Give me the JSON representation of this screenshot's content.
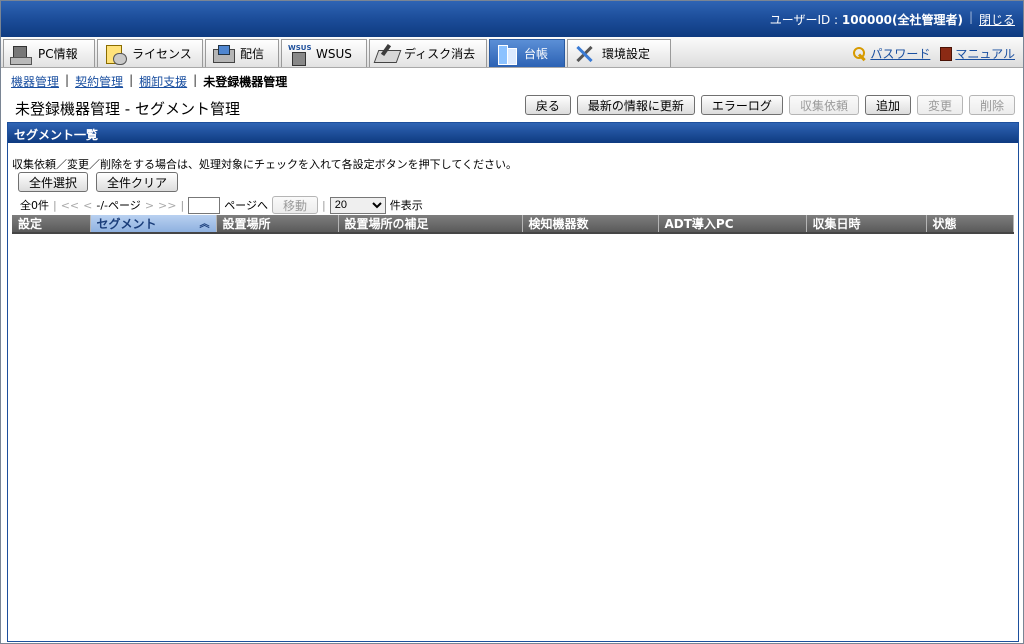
{
  "topbar": {
    "user_label": "ユーザーID : ",
    "user_id": "100000(全社管理者)",
    "separator": "|",
    "logout": "閉じる"
  },
  "menu": {
    "tabs": [
      {
        "label": "PC情報",
        "icon": "pc-icon"
      },
      {
        "label": "ライセンス",
        "icon": "license-icon"
      },
      {
        "label": "配信",
        "icon": "distribution-icon"
      },
      {
        "label": "WSUS",
        "icon": "wsus-icon",
        "icon_text": "WSUS"
      },
      {
        "label": "ディスク消去",
        "icon": "disk-erase-icon"
      },
      {
        "label": "台帳",
        "icon": "ledger-icon",
        "active": true
      },
      {
        "label": "環境設定",
        "icon": "tools-icon"
      }
    ],
    "password": "パスワード",
    "manual": "マニュアル"
  },
  "breadcrumb": {
    "items": [
      "機器管理",
      "契約管理",
      "棚卸支援"
    ],
    "current": "未登録機器管理",
    "separator": "|"
  },
  "page": {
    "title": "未登録機器管理 - セグメント管理"
  },
  "toolbar": {
    "back": "戻る",
    "refresh": "最新の情報に更新",
    "error_log": "エラーログ",
    "collect": "収集依頼",
    "add": "追加",
    "change": "変更",
    "delete": "削除"
  },
  "section": {
    "title": "セグメント一覧",
    "description": "収集依頼／変更／削除をする場合は、処理対象にチェックを入れて各設定ボタンを押下してください。",
    "select_all": "全件選択",
    "clear_all": "全件クリア"
  },
  "pager": {
    "total": "全0件",
    "first": "<<",
    "prev": "<",
    "page_info": "-/-ページ",
    "next": ">",
    "last": ">>",
    "page_input": "",
    "goto_suffix": "ページへ",
    "move": "移動",
    "per_page": "20",
    "per_page_suffix": "件表示",
    "bar": "|"
  },
  "table": {
    "columns": [
      "設定",
      "セグメント",
      "設置場所",
      "設置場所の補足",
      "検知機器数",
      "ADT導入PC",
      "収集日時",
      "状態"
    ],
    "sort_indicator": "︽",
    "rows": []
  },
  "colors": {
    "header_blue": "#1d4f9c",
    "active_tab": "#2c62b4",
    "link": "#1a4fa0",
    "table_header": "#5a5a5a",
    "sorted_header": "#8fb1e0"
  }
}
